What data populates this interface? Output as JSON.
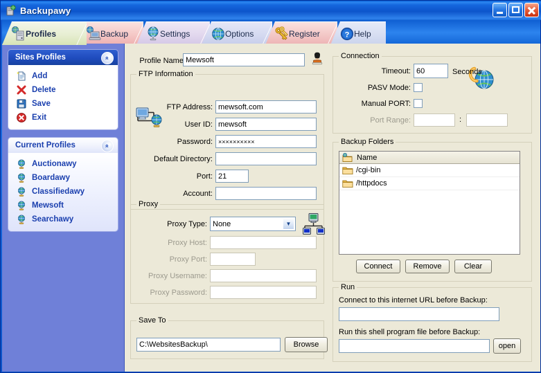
{
  "window": {
    "title": "Backupawy",
    "icon": "app-backup-icon",
    "buttons": {
      "minimize": "minimize",
      "maximize": "maximize",
      "close": "close"
    }
  },
  "tabs": [
    {
      "label": "Profiles",
      "icon": "profiles-icon",
      "active": true
    },
    {
      "label": "Backup",
      "icon": "backup-icon",
      "active": false
    },
    {
      "label": "Settings",
      "icon": "globe-icon",
      "active": false
    },
    {
      "label": "Options",
      "icon": "globe2-icon",
      "active": false
    },
    {
      "label": "Register",
      "icon": "keys-icon",
      "active": false
    },
    {
      "label": "Help",
      "icon": "help-icon",
      "active": false
    }
  ],
  "sidebar": {
    "panels": [
      {
        "title": "Sites Profiles",
        "collapse_glyph": "«",
        "items": [
          {
            "label": "Add",
            "icon": "new-document-icon"
          },
          {
            "label": "Delete",
            "icon": "red-x-icon"
          },
          {
            "label": "Save",
            "icon": "floppy-disk-icon"
          },
          {
            "label": "Exit",
            "icon": "red-circle-x-icon"
          }
        ]
      },
      {
        "title": "Current Profiles",
        "collapse_glyph": "«",
        "items": [
          {
            "label": "Auctionawy",
            "icon": "globe-small-icon"
          },
          {
            "label": "Boardawy",
            "icon": "globe-small-icon"
          },
          {
            "label": "Classifiedawy",
            "icon": "globe-small-icon"
          },
          {
            "label": "Mewsoft",
            "icon": "globe-small-icon"
          },
          {
            "label": "Searchawy",
            "icon": "globe-small-icon"
          }
        ]
      }
    ]
  },
  "main": {
    "profile_name": {
      "label": "Profile Name:",
      "value": "Mewsoft",
      "placeholder": "",
      "icon": "user-head-icon"
    },
    "ftp_information": {
      "legend": "FTP Information",
      "icon": "network-computer-icon",
      "fields": [
        {
          "label": "FTP Address:",
          "value": "mewsoft.com",
          "disabled": false
        },
        {
          "label": "User ID:",
          "value": "mewsoft",
          "disabled": false
        },
        {
          "label": "Password:",
          "value": "××××××××××",
          "disabled": false
        },
        {
          "label": "Default Directory:",
          "value": "",
          "disabled": false
        },
        {
          "label": "Port:",
          "value": "21",
          "disabled": false
        },
        {
          "label": "Account:",
          "value": "",
          "disabled": false
        }
      ]
    },
    "proxy": {
      "legend": "Proxy",
      "icon": "proxy-network-icon",
      "type_label": "Proxy Type:",
      "type_value": "None",
      "type_options": [
        "None"
      ],
      "fields": [
        {
          "label": "Proxy Host:",
          "value": "",
          "disabled": true
        },
        {
          "label": "Proxy Port:",
          "value": "",
          "disabled": true
        },
        {
          "label": "Proxy Username:",
          "value": "",
          "disabled": true
        },
        {
          "label": "Proxy Password:",
          "value": "",
          "disabled": true
        }
      ]
    },
    "save_to": {
      "legend": "Save To",
      "value": "C:\\WebsitesBackup\\",
      "browse_label": "Browse",
      "browse_accel": "B"
    },
    "connection": {
      "legend": "Connection",
      "icon": "connection-globe-icon",
      "timeout_label": "Timeout:",
      "timeout_value": "60",
      "seconds_label": "Seconds",
      "pasv_label": "PASV Mode:",
      "pasv_checked": false,
      "manual_port_label": "Manual PORT:",
      "manual_port_checked": false,
      "port_range_label": "Port Range:",
      "port_range_from": "",
      "port_range_to": "",
      "port_range_separator": ":",
      "port_range_disabled": true
    },
    "backup_folders": {
      "legend": "Backup Folders",
      "column_header": "Name",
      "header_icon": "folders-icon",
      "rows": [
        {
          "name": "/cgi-bin",
          "icon": "folder-icon"
        },
        {
          "name": "/httpdocs",
          "icon": "folder-icon"
        }
      ],
      "buttons": [
        {
          "label": "Connect",
          "accel": "C"
        },
        {
          "label": "Remove",
          "accel": "R"
        },
        {
          "label": "Clear",
          "accel": "l"
        }
      ]
    },
    "run": {
      "legend": "Run",
      "url_label": "Connect to this internet URL before Backup:",
      "url_value": "",
      "shell_label": "Run this shell program file before Backup:",
      "shell_value": "",
      "open_label": "open"
    }
  },
  "colors": {
    "title_blue": "#0b53c8",
    "sidebar_blue": "#6f80d8",
    "panel_header_blue": "#1f4bbd",
    "sidebar_link": "#1a3fae",
    "client_bg": "#ece9d8",
    "field_border": "#7f9db9",
    "disabled_text": "#9c9a8e"
  }
}
